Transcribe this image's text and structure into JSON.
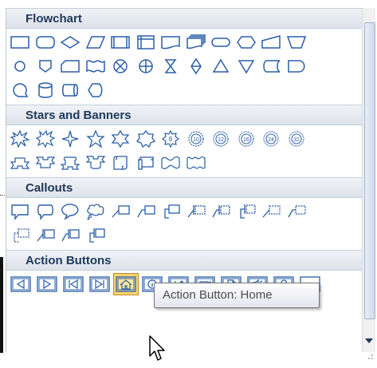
{
  "categories": {
    "flowchart": "Flowchart",
    "stars": "Stars and Banners",
    "callouts": "Callouts",
    "action_buttons": "Action Buttons"
  },
  "tooltip": "Action Button: Home",
  "selected_shape": "action-button-home",
  "colors": {
    "shape_stroke": "#2a5ea8",
    "header_text": "#1e395b",
    "selected_fill": "#fcd46c"
  },
  "icons": {
    "scroll_down": "chevron-down-icon",
    "resize": "resize-grip-icon",
    "cursor": "mouse-pointer-icon"
  }
}
